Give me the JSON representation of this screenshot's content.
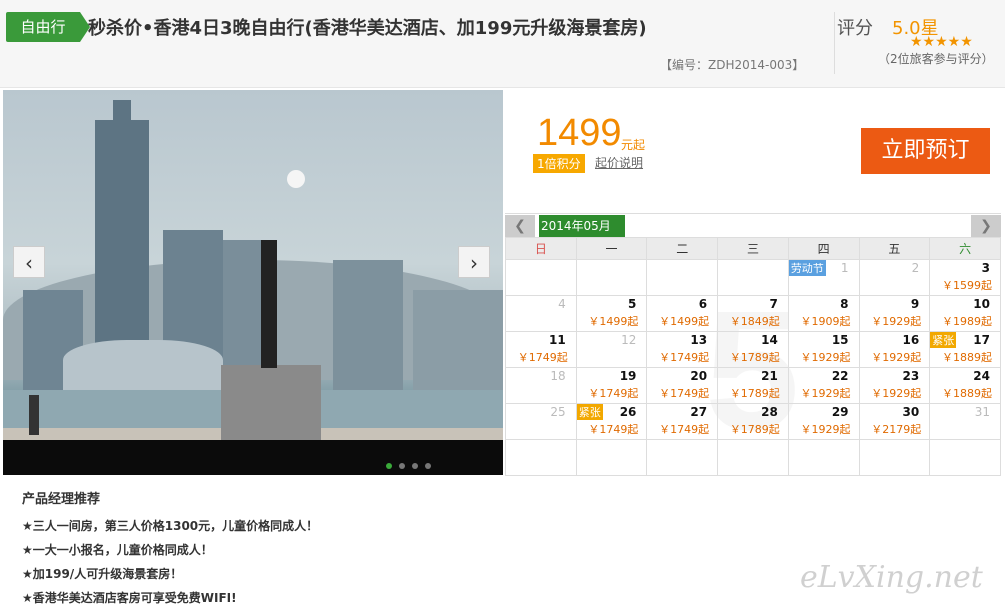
{
  "header": {
    "badge": "自由行",
    "title": "秒杀价•香港4日3晚自由行(香港华美达酒店、加199元升级海景套房)",
    "code": "【编号：ZDH2014-003】",
    "rating_label": "评分",
    "rating_value": "5.0星",
    "stars": "★★★★★",
    "reviews": "（2位旅客参与评分）"
  },
  "price": {
    "amount": "1499",
    "unit": "元起",
    "points": "1倍积分",
    "help": "起价说明",
    "book": "立即预订"
  },
  "calendar": {
    "month": "2014年05月",
    "prev": "❮",
    "next": "❯",
    "weekdays": [
      "日",
      "一",
      "二",
      "三",
      "四",
      "五",
      "六"
    ],
    "weeks": [
      [
        {
          "d": ""
        },
        {
          "d": ""
        },
        {
          "d": ""
        },
        {
          "d": ""
        },
        {
          "d": "1",
          "dim": true,
          "tag": "劳动节",
          "tagColor": "blue"
        },
        {
          "d": "2",
          "dim": true
        },
        {
          "d": "3",
          "p": "￥1599起"
        }
      ],
      [
        {
          "d": "4",
          "dim": true
        },
        {
          "d": "5",
          "p": "￥1499起"
        },
        {
          "d": "6",
          "p": "￥1499起"
        },
        {
          "d": "7",
          "p": "￥1849起"
        },
        {
          "d": "8",
          "p": "￥1909起"
        },
        {
          "d": "9",
          "p": "￥1929起"
        },
        {
          "d": "10",
          "p": "￥1989起"
        }
      ],
      [
        {
          "d": "11",
          "p": "￥1749起"
        },
        {
          "d": "12",
          "dim": true
        },
        {
          "d": "13",
          "p": "￥1749起"
        },
        {
          "d": "14",
          "p": "￥1789起"
        },
        {
          "d": "15",
          "p": "￥1929起"
        },
        {
          "d": "16",
          "p": "￥1929起"
        },
        {
          "d": "17",
          "p": "￥1889起",
          "tag": "紧张",
          "tagColor": "orange"
        }
      ],
      [
        {
          "d": "18",
          "dim": true
        },
        {
          "d": "19",
          "p": "￥1749起"
        },
        {
          "d": "20",
          "p": "￥1749起"
        },
        {
          "d": "21",
          "p": "￥1789起"
        },
        {
          "d": "22",
          "p": "￥1929起"
        },
        {
          "d": "23",
          "p": "￥1929起"
        },
        {
          "d": "24",
          "p": "￥1889起"
        }
      ],
      [
        {
          "d": "25",
          "dim": true
        },
        {
          "d": "26",
          "p": "￥1749起",
          "tag": "紧张",
          "tagColor": "orange"
        },
        {
          "d": "27",
          "p": "￥1749起"
        },
        {
          "d": "28",
          "p": "￥1789起"
        },
        {
          "d": "29",
          "p": "￥1929起"
        },
        {
          "d": "30",
          "p": "￥2179起"
        },
        {
          "d": "31",
          "dim": true
        }
      ],
      [
        {
          "d": ""
        },
        {
          "d": ""
        },
        {
          "d": ""
        },
        {
          "d": ""
        },
        {
          "d": ""
        },
        {
          "d": ""
        },
        {
          "d": ""
        }
      ]
    ]
  },
  "recommend": {
    "title": "产品经理推荐",
    "items": [
      "★三人一间房，第三人价格1300元，儿童价格同成人！",
      "★一大一小报名，儿童价格同成人！",
      "★加199/人可升级海景套房！",
      "★香港华美达酒店客房可享受免费WIFI!"
    ]
  },
  "watermark": "eLvXing.net",
  "colors": {
    "accent_green": "#3a9a3a",
    "price_orange": "#f28a00",
    "book_button": "#ec5a13"
  }
}
